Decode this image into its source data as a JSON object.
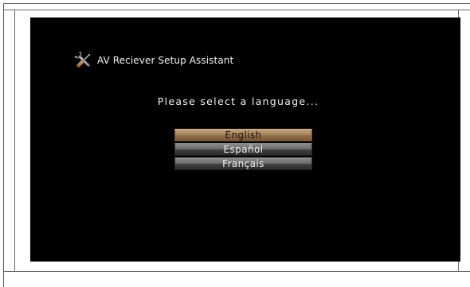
{
  "app": {
    "title": "AV Reciever Setup Assistant",
    "icon": "tools-icon"
  },
  "prompt": "Please select a language...",
  "languages": [
    {
      "label": "English",
      "selected": true
    },
    {
      "label": "Español",
      "selected": false
    },
    {
      "label": "Français",
      "selected": false
    }
  ],
  "colors": {
    "screen_background": "#000000",
    "selected_button": "#a7865f",
    "button": "#6e6e6e",
    "text": "#f2f2f2"
  }
}
